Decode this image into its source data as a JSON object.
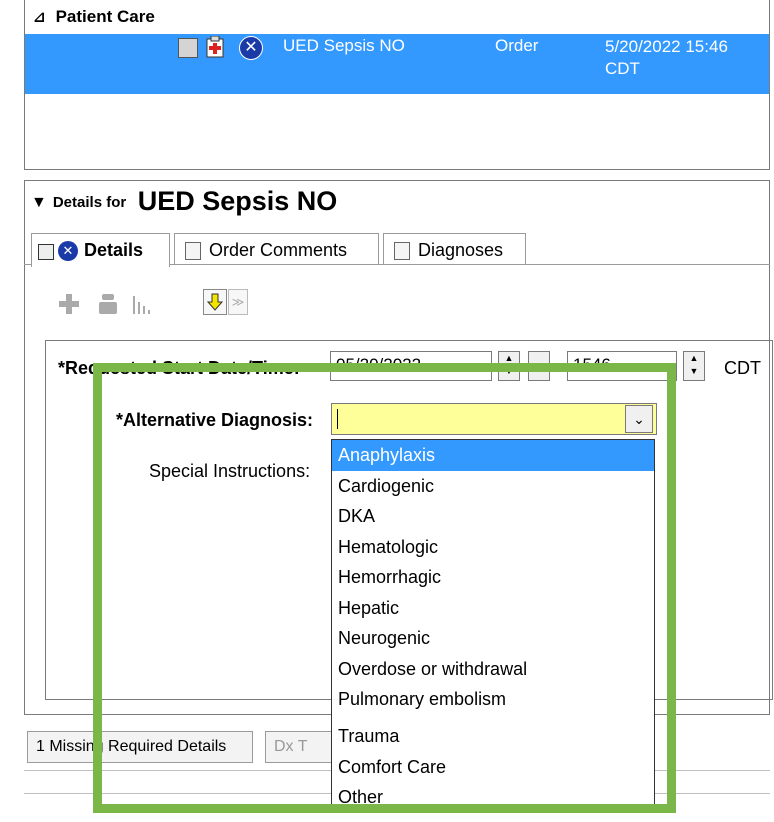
{
  "orders": {
    "group_label": "Patient Care",
    "row": {
      "name": "UED Sepsis NO",
      "type": "Order",
      "datetime": "5/20/2022 15:46 CDT"
    }
  },
  "details": {
    "prefix": "Details for",
    "title": "UED Sepsis NO",
    "tabs": [
      {
        "label": "Details"
      },
      {
        "label": "Order Comments"
      },
      {
        "label": "Diagnoses"
      }
    ]
  },
  "form": {
    "start_label": "*Requested Start Date/Time:",
    "start_date": "05/20/2022",
    "start_time": "1546",
    "timezone": "CDT",
    "alt_dx_label": "*Alternative Diagnosis:",
    "alt_dx_value": "",
    "special_label": "Special Instructions:"
  },
  "dropdown_options": [
    "Anaphylaxis",
    "Cardiogenic",
    "DKA",
    "Hematologic",
    "Hemorrhagic",
    "Hepatic",
    "Neurogenic",
    "Overdose or withdrawal",
    "Pulmonary embolism",
    "Trauma",
    "Comfort Care",
    "Other"
  ],
  "selected_option": "Anaphylaxis",
  "footer": {
    "missing_button": "1 Missing Required Details",
    "dx_button": "Dx T"
  },
  "colors": {
    "selection": "#3399ff",
    "highlight_box": "#7ab648",
    "required_field": "#ffff99"
  }
}
